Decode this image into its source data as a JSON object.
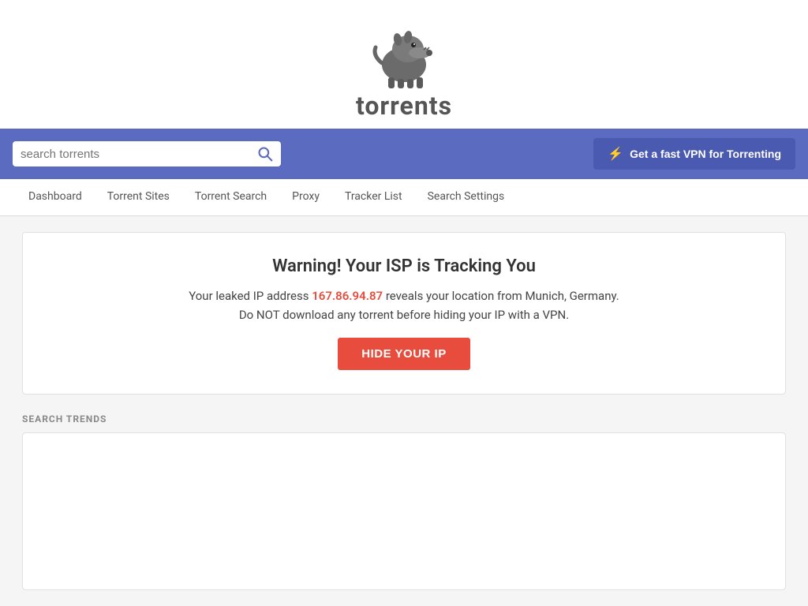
{
  "header": {
    "logo_text": "torrents",
    "logo_alt": "Torrents logo - anteater"
  },
  "search": {
    "placeholder": "search torrents",
    "current_value": ""
  },
  "vpn_button": {
    "label": "Get a fast VPN for Torrenting",
    "bolt_icon": "⚡"
  },
  "navbar": {
    "items": [
      {
        "label": "Dashboard",
        "id": "dashboard"
      },
      {
        "label": "Torrent Sites",
        "id": "torrent-sites"
      },
      {
        "label": "Torrent Search",
        "id": "torrent-search"
      },
      {
        "label": "Proxy",
        "id": "proxy"
      },
      {
        "label": "Tracker List",
        "id": "tracker-list"
      },
      {
        "label": "Search Settings",
        "id": "search-settings"
      }
    ]
  },
  "warning": {
    "title": "Warning! Your ISP is Tracking You",
    "text1_prefix": "Your leaked IP address ",
    "ip_address": "167.86.94.87",
    "text1_suffix": " reveals your location from Munich, Germany.",
    "text2": "Do NOT download any torrent before hiding your IP with a VPN.",
    "hide_ip_label": "HIDE YOUR IP"
  },
  "search_trends": {
    "section_label": "SEARCH TRENDS"
  }
}
